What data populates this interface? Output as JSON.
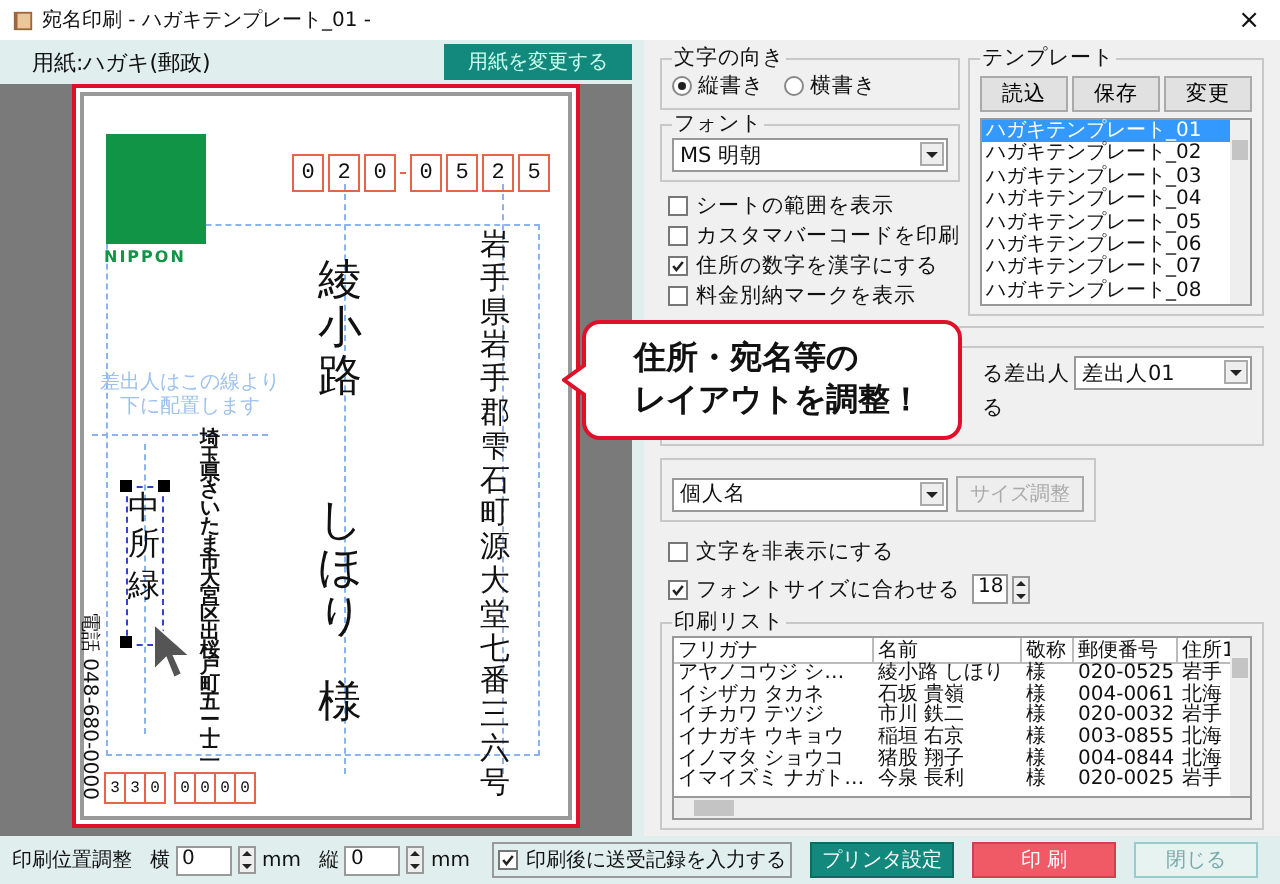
{
  "window": {
    "title": "宛名印刷 - ハガキテンプレート_01 -",
    "close": "×"
  },
  "paper": {
    "label": "用紙:ハガキ(郵政)",
    "change_button": "用紙を変更する"
  },
  "postcard": {
    "stamp_label": "NIPPON",
    "postal_code": [
      "0",
      "2",
      "0",
      "0",
      "5",
      "2",
      "5"
    ],
    "address": "岩手県岩手郡雫石町源大堂七番三六号",
    "recipient_family": "綾小路",
    "recipient_given": "しほり",
    "honorific": "様",
    "guide_note": "差出人はこの線より下に配置します",
    "sender_address": "埼玉県さいたま市大宮区出桜戸町五ー十二",
    "sender_family": "中所",
    "sender_given": "緑",
    "sender_phone": "電話 048-680-0000",
    "sender_postal_code": [
      "3",
      "3",
      "0",
      "0",
      "0",
      "0",
      "0"
    ]
  },
  "callout": [
    "住所・宛名等の",
    "レイアウトを調整！"
  ],
  "direction": {
    "title": "文字の向き",
    "options": [
      {
        "label": "縦書き",
        "selected": true
      },
      {
        "label": "横書き",
        "selected": false
      }
    ]
  },
  "font": {
    "title": "フォント",
    "value": "MS 明朝"
  },
  "options": [
    {
      "label": "シートの範囲を表示",
      "checked": false
    },
    {
      "label": "カスタマバーコードを印刷",
      "checked": false
    },
    {
      "label": "住所の数字を漢字にする",
      "checked": true
    },
    {
      "label": "料金別納マークを表示",
      "checked": false
    }
  ],
  "template": {
    "title": "テンプレート",
    "buttons": [
      "読込",
      "保存",
      "変更"
    ],
    "items": [
      {
        "label": "ハガキテンプレート_01",
        "selected": true
      },
      {
        "label": "ハガキテンプレート_02",
        "selected": false
      },
      {
        "label": "ハガキテンプレート_03",
        "selected": false
      },
      {
        "label": "ハガキテンプレート_04",
        "selected": false
      },
      {
        "label": "ハガキテンプレート_05",
        "selected": false
      },
      {
        "label": "ハガキテンプレート_06",
        "selected": false
      },
      {
        "label": "ハガキテンプレート_07",
        "selected": false
      },
      {
        "label": "ハガキテンプレート_08",
        "selected": false
      }
    ]
  },
  "sender": {
    "label_fragment": "る差出人",
    "value": "差出人01",
    "line_fragment": "る"
  },
  "name_type": {
    "value": "個人名",
    "size_button": "サイズ調整",
    "size_button_disabled": true
  },
  "hide_text": {
    "label": "文字を非表示にする",
    "checked": false
  },
  "fit_font": {
    "label": "フォントサイズに合わせる",
    "checked": true,
    "size": "18"
  },
  "print_list": {
    "title": "印刷リスト",
    "columns": [
      "フリガナ",
      "名前",
      "敬称",
      "郵便番号",
      "住所1"
    ],
    "rows": [
      [
        "アヤノコウジ シ…",
        "綾小路 しほり",
        "様",
        "020-0525",
        "岩手"
      ],
      [
        "イシザカ タカネ",
        "石坂 貴嶺",
        "様",
        "004-0061",
        "北海"
      ],
      [
        "イチカワ テツジ",
        "市川 鉄二",
        "様",
        "020-0032",
        "岩手"
      ],
      [
        "イナガキ ウキョウ",
        "稲垣 右京",
        "様",
        "003-0855",
        "北海"
      ],
      [
        "イノマタ ショウコ",
        "猪股 翔子",
        "様",
        "004-0844",
        "北海"
      ],
      [
        "イマイズミ ナガト…",
        "今泉 長利",
        "様",
        "020-0025",
        "岩手"
      ]
    ]
  },
  "bottom": {
    "offset_label": "印刷位置調整",
    "x_label": "横",
    "x_value": "0",
    "x_unit": "mm",
    "y_label": "縦",
    "y_value": "0",
    "y_unit": "mm",
    "record": {
      "label": "印刷後に送受記録を入力する",
      "checked": true
    },
    "buttons": [
      {
        "label": "プリンタ設定",
        "kind": "primary"
      },
      {
        "label": "印 刷",
        "kind": "danger"
      },
      {
        "label": "閉じる",
        "kind": "plain"
      }
    ]
  }
}
